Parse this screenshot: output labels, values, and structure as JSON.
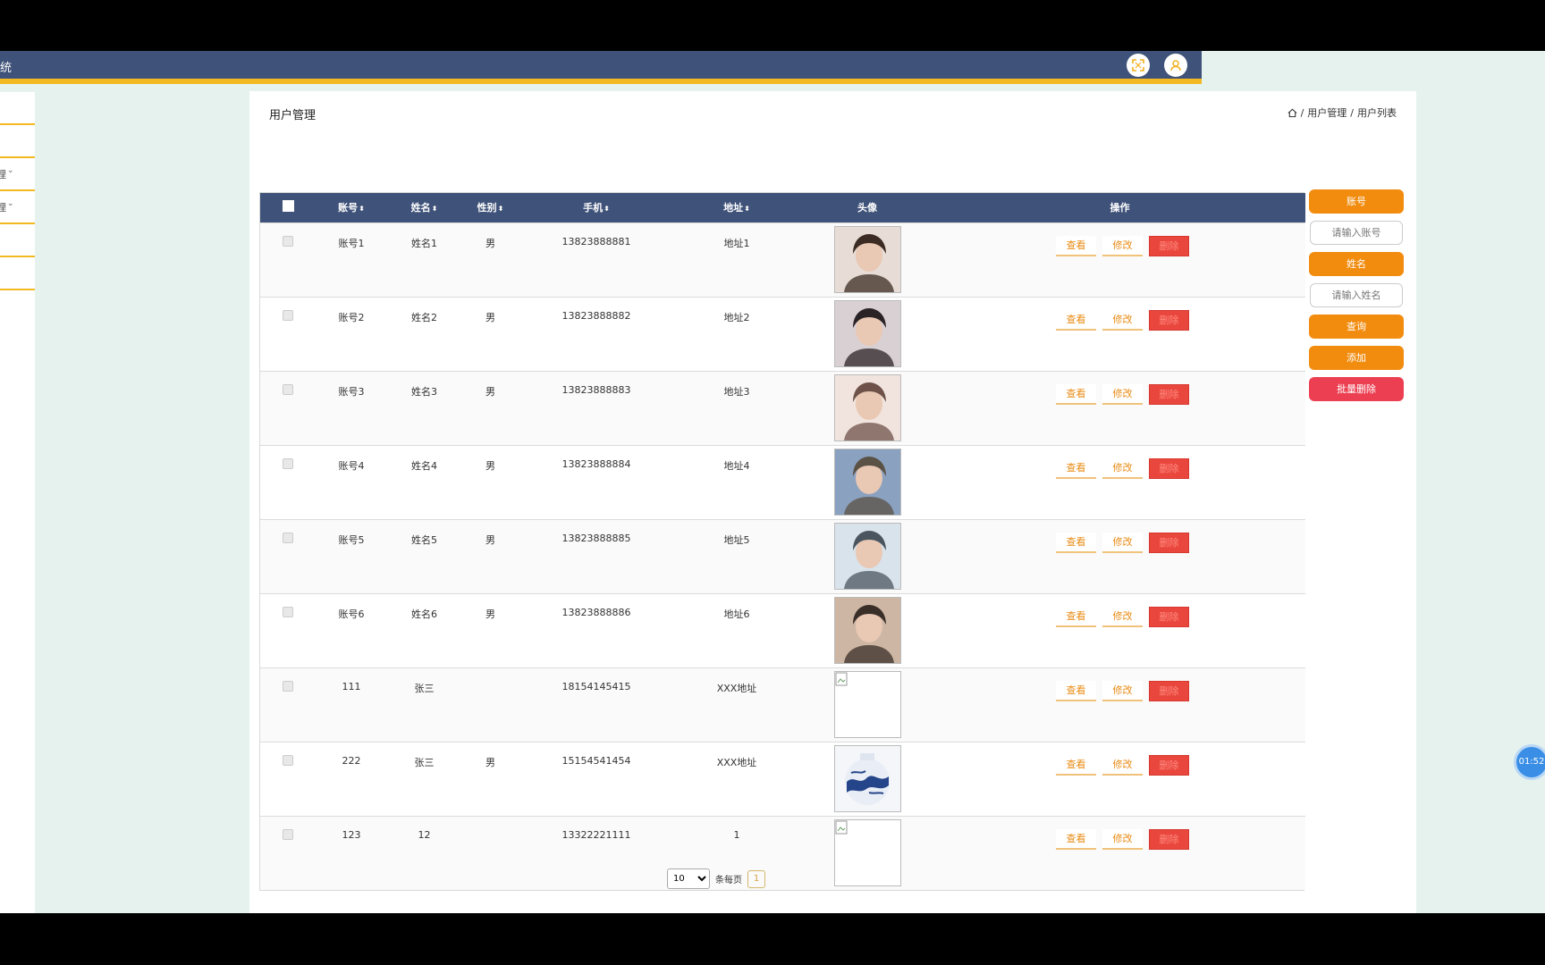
{
  "header": {
    "app_title": "统"
  },
  "sidebar": {
    "items": [
      {
        "label": "-",
        "has_chevron": false
      },
      {
        "label": "-",
        "has_chevron": false
      },
      {
        "label": "理",
        "has_chevron": true
      },
      {
        "label": "理",
        "has_chevron": true
      },
      {
        "label": "-",
        "has_chevron": false
      },
      {
        "label": "-",
        "has_chevron": false
      }
    ]
  },
  "page": {
    "title": "用户管理",
    "breadcrumb": [
      "用户管理",
      "用户列表"
    ]
  },
  "table": {
    "columns": [
      "账号",
      "姓名",
      "性别",
      "手机",
      "地址",
      "头像",
      "操作"
    ],
    "actions": {
      "view": "查看",
      "edit": "修改",
      "delete": "删除"
    },
    "rows": [
      {
        "account": "账号1",
        "name": "姓名1",
        "gender": "男",
        "phone": "13823888881",
        "address": "地址1",
        "avatar": "photo",
        "avatar_colors": [
          "#e7ddd6",
          "#3b2b22"
        ]
      },
      {
        "account": "账号2",
        "name": "姓名2",
        "gender": "男",
        "phone": "13823888882",
        "address": "地址2",
        "avatar": "photo",
        "avatar_colors": [
          "#d9d0d4",
          "#2a2325"
        ]
      },
      {
        "account": "账号3",
        "name": "姓名3",
        "gender": "男",
        "phone": "13823888883",
        "address": "地址3",
        "avatar": "photo",
        "avatar_colors": [
          "#f1e4de",
          "#6e5249"
        ]
      },
      {
        "account": "账号4",
        "name": "姓名4",
        "gender": "男",
        "phone": "13823888884",
        "address": "地址4",
        "avatar": "photo",
        "avatar_colors": [
          "#8aa1c0",
          "#5b5246"
        ]
      },
      {
        "account": "账号5",
        "name": "姓名5",
        "gender": "男",
        "phone": "13823888885",
        "address": "地址5",
        "avatar": "photo",
        "avatar_colors": [
          "#d9e3ec",
          "#4a5560"
        ]
      },
      {
        "account": "账号6",
        "name": "姓名6",
        "gender": "男",
        "phone": "13823888886",
        "address": "地址6",
        "avatar": "photo",
        "avatar_colors": [
          "#cdb7a4",
          "#3a2e28"
        ]
      },
      {
        "account": "111",
        "name": "张三",
        "gender": "",
        "phone": "18154145415",
        "address": "XXX地址",
        "avatar": "broken",
        "avatar_colors": [
          "#ffffff",
          "#ffffff"
        ]
      },
      {
        "account": "222",
        "name": "张三",
        "gender": "男",
        "phone": "15154541454",
        "address": "XXX地址",
        "avatar": "vase",
        "avatar_colors": [
          "#f4f6fa",
          "#25458a"
        ]
      },
      {
        "account": "123",
        "name": "12",
        "gender": "",
        "phone": "13322221111",
        "address": "1",
        "avatar": "broken",
        "avatar_colors": [
          "#ffffff",
          "#ffffff"
        ]
      }
    ]
  },
  "search": {
    "account_label": "账号",
    "account_placeholder": "请输入账号",
    "name_label": "姓名",
    "name_placeholder": "请输入姓名",
    "query_button": "查询",
    "add_button": "添加",
    "batch_delete_button": "批量删除"
  },
  "pagination": {
    "page_size": "10",
    "page_size_options": [
      "10"
    ],
    "per_page_label": "条每页",
    "current_page": "1"
  },
  "overlay": {
    "timer": "01:52"
  },
  "colors": {
    "header_bg": "#3f5279",
    "header_accent": "#f3b922",
    "primary_orange": "#f28c0f",
    "danger_red": "#e9473d",
    "page_bg": "#e6f2ee"
  }
}
